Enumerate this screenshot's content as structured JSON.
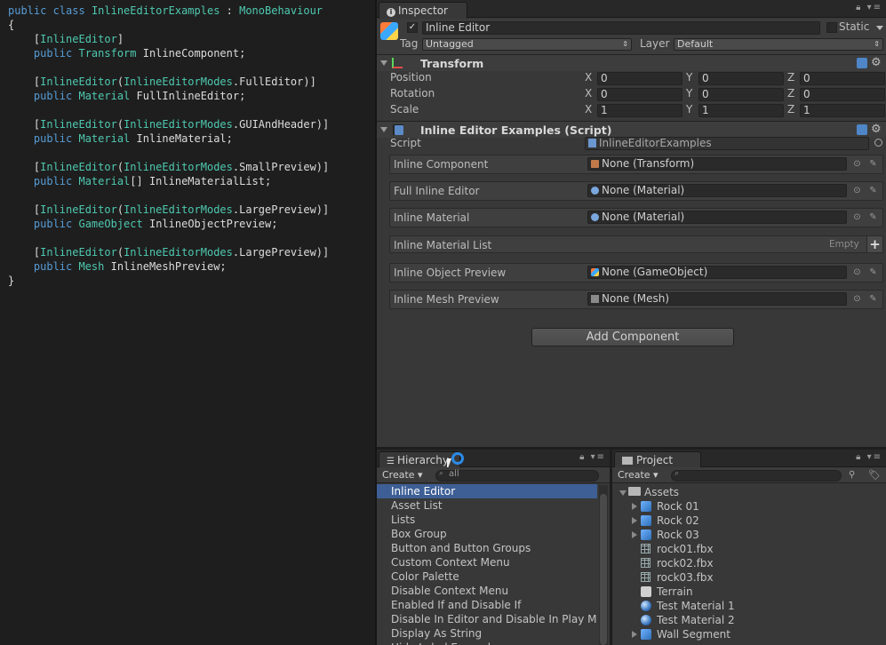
{
  "code": {
    "lines": [
      [
        {
          "t": "public ",
          "c": "kw"
        },
        {
          "t": "class ",
          "c": "kw"
        },
        {
          "t": "InlineEditorExamples ",
          "c": "ty"
        },
        {
          "t": ": ",
          "c": "pn"
        },
        {
          "t": "MonoBehaviour",
          "c": "ty"
        }
      ],
      [
        {
          "t": "{",
          "c": "pn"
        }
      ],
      [
        {
          "t": "    [",
          "c": "pn"
        },
        {
          "t": "InlineEditor",
          "c": "ty"
        },
        {
          "t": "]",
          "c": "pn"
        }
      ],
      [
        {
          "t": "    public ",
          "c": "kw"
        },
        {
          "t": "Transform ",
          "c": "ty"
        },
        {
          "t": "InlineComponent;",
          "c": "id"
        }
      ],
      [],
      [
        {
          "t": "    [",
          "c": "pn"
        },
        {
          "t": "InlineEditor",
          "c": "ty"
        },
        {
          "t": "(",
          "c": "pn"
        },
        {
          "t": "InlineEditorModes",
          "c": "ty"
        },
        {
          "t": ".FullEditor)]",
          "c": "pn"
        }
      ],
      [
        {
          "t": "    public ",
          "c": "kw"
        },
        {
          "t": "Material ",
          "c": "ty"
        },
        {
          "t": "FullInlineEditor;",
          "c": "id"
        }
      ],
      [],
      [
        {
          "t": "    [",
          "c": "pn"
        },
        {
          "t": "InlineEditor",
          "c": "ty"
        },
        {
          "t": "(",
          "c": "pn"
        },
        {
          "t": "InlineEditorModes",
          "c": "ty"
        },
        {
          "t": ".GUIAndHeader)]",
          "c": "pn"
        }
      ],
      [
        {
          "t": "    public ",
          "c": "kw"
        },
        {
          "t": "Material ",
          "c": "ty"
        },
        {
          "t": "InlineMaterial;",
          "c": "id"
        }
      ],
      [],
      [
        {
          "t": "    [",
          "c": "pn"
        },
        {
          "t": "InlineEditor",
          "c": "ty"
        },
        {
          "t": "(",
          "c": "pn"
        },
        {
          "t": "InlineEditorModes",
          "c": "ty"
        },
        {
          "t": ".SmallPreview)]",
          "c": "pn"
        }
      ],
      [
        {
          "t": "    public ",
          "c": "kw"
        },
        {
          "t": "Material",
          "c": "ty"
        },
        {
          "t": "[] InlineMaterialList;",
          "c": "id"
        }
      ],
      [],
      [
        {
          "t": "    [",
          "c": "pn"
        },
        {
          "t": "InlineEditor",
          "c": "ty"
        },
        {
          "t": "(",
          "c": "pn"
        },
        {
          "t": "InlineEditorModes",
          "c": "ty"
        },
        {
          "t": ".LargePreview)]",
          "c": "pn"
        }
      ],
      [
        {
          "t": "    public ",
          "c": "kw"
        },
        {
          "t": "GameObject ",
          "c": "ty"
        },
        {
          "t": "InlineObjectPreview;",
          "c": "id"
        }
      ],
      [],
      [
        {
          "t": "    [",
          "c": "pn"
        },
        {
          "t": "InlineEditor",
          "c": "ty"
        },
        {
          "t": "(",
          "c": "pn"
        },
        {
          "t": "InlineEditorModes",
          "c": "ty"
        },
        {
          "t": ".LargePreview)]",
          "c": "pn"
        }
      ],
      [
        {
          "t": "    public ",
          "c": "kw"
        },
        {
          "t": "Mesh ",
          "c": "ty"
        },
        {
          "t": "InlineMeshPreview;",
          "c": "id"
        }
      ],
      [
        {
          "t": "}",
          "c": "pn"
        }
      ]
    ]
  },
  "inspector": {
    "tab_label": "Inspector",
    "object_name": "Inline Editor",
    "static_label": "Static",
    "tag_label": "Tag",
    "tag_value": "Untagged",
    "layer_label": "Layer",
    "layer_value": "Default",
    "transform": {
      "title": "Transform",
      "rows": [
        {
          "label": "Position",
          "x": "0",
          "y": "0",
          "z": "0"
        },
        {
          "label": "Rotation",
          "x": "0",
          "y": "0",
          "z": "0"
        },
        {
          "label": "Scale",
          "x": "1",
          "y": "1",
          "z": "1"
        }
      ],
      "axis": {
        "x": "X",
        "y": "Y",
        "z": "Z"
      }
    },
    "script_component": {
      "title": "Inline Editor Examples (Script)",
      "script_label": "Script",
      "script_value": "InlineEditorExamples",
      "fields": [
        {
          "label": "Inline Component",
          "value": "None (Transform)",
          "icon": "transform-icon"
        },
        {
          "label": "Full Inline Editor",
          "value": "None (Material)",
          "icon": "material-icon"
        },
        {
          "label": "Inline Material",
          "value": "None (Material)",
          "icon": "material-icon"
        },
        {
          "label": "Inline Material List",
          "value": "",
          "icon": ""
        },
        {
          "label": "Inline Object Preview",
          "value": "None (GameObject)",
          "icon": "gameobject-icon"
        },
        {
          "label": "Inline Mesh Preview",
          "value": "None (Mesh)",
          "icon": "mesh-icon"
        }
      ],
      "list_empty_label": "Empty"
    },
    "add_component_label": "Add Component"
  },
  "hierarchy": {
    "tab_label": "Hierarchy",
    "create_label": "Create",
    "search_value": "all",
    "items": [
      "Inline Editor",
      "Asset List",
      "Lists",
      "Box Group",
      "Button and Button Groups",
      "Custom Context Menu",
      "Color Palette",
      "Disable Context Menu",
      "Enabled If and Disable If",
      "Disable In Editor and Disable In Play Mo",
      "Display As String",
      "Hide Label Example"
    ],
    "selected_index": 0
  },
  "project": {
    "tab_label": "Project",
    "create_label": "Create",
    "items": [
      {
        "label": "Assets",
        "icon": "folder",
        "indent": 0,
        "expand": "open"
      },
      {
        "label": "Rock 01",
        "icon": "prefab",
        "indent": 1,
        "expand": "closed"
      },
      {
        "label": "Rock 02",
        "icon": "prefab",
        "indent": 1,
        "expand": "closed"
      },
      {
        "label": "Rock 03",
        "icon": "prefab",
        "indent": 1,
        "expand": "closed"
      },
      {
        "label": "rock01.fbx",
        "icon": "mesh",
        "indent": 1,
        "expand": "none"
      },
      {
        "label": "rock02.fbx",
        "icon": "mesh",
        "indent": 1,
        "expand": "none"
      },
      {
        "label": "rock03.fbx",
        "icon": "mesh",
        "indent": 1,
        "expand": "none"
      },
      {
        "label": "Terrain",
        "icon": "gameobject",
        "indent": 1,
        "expand": "none"
      },
      {
        "label": "Test Material 1",
        "icon": "material",
        "indent": 1,
        "expand": "none"
      },
      {
        "label": "Test Material 2",
        "icon": "material",
        "indent": 1,
        "expand": "none"
      },
      {
        "label": "Wall Segment",
        "icon": "prefab",
        "indent": 1,
        "expand": "closed"
      }
    ]
  }
}
